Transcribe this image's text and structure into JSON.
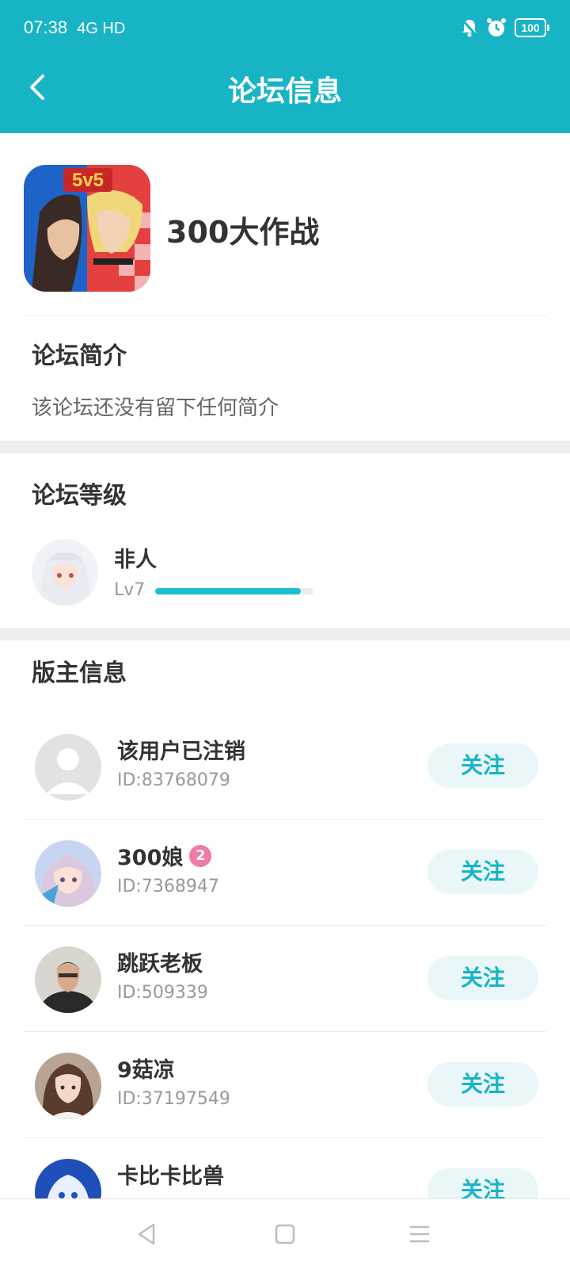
{
  "status": {
    "time": "07:38",
    "network": "4G HD",
    "battery": "100"
  },
  "header": {
    "title": "论坛信息"
  },
  "forum": {
    "icon_text": "5v5",
    "name": "300大作战"
  },
  "intro": {
    "title": "论坛简介",
    "text": "该论坛还没有留下任何简介"
  },
  "level": {
    "title": "论坛等级",
    "name": "非人",
    "tag": "Lv7",
    "progress": 0.92
  },
  "moderators": {
    "title": "版主信息",
    "follow_label": "关注",
    "items": [
      {
        "name": "该用户已注销",
        "id": "ID:83768079"
      },
      {
        "name": "300娘",
        "badge": "2",
        "id": "ID:7368947"
      },
      {
        "name": "跳跃老板",
        "id": "ID:509339"
      },
      {
        "name": "9菇凉",
        "id": "ID:37197549"
      },
      {
        "name": "卡比卡比兽",
        "id": ""
      }
    ]
  },
  "colors": {
    "accent": "#17b4c6",
    "follow_bg": "#e9f7f8",
    "badge": "#ef7ba8"
  }
}
